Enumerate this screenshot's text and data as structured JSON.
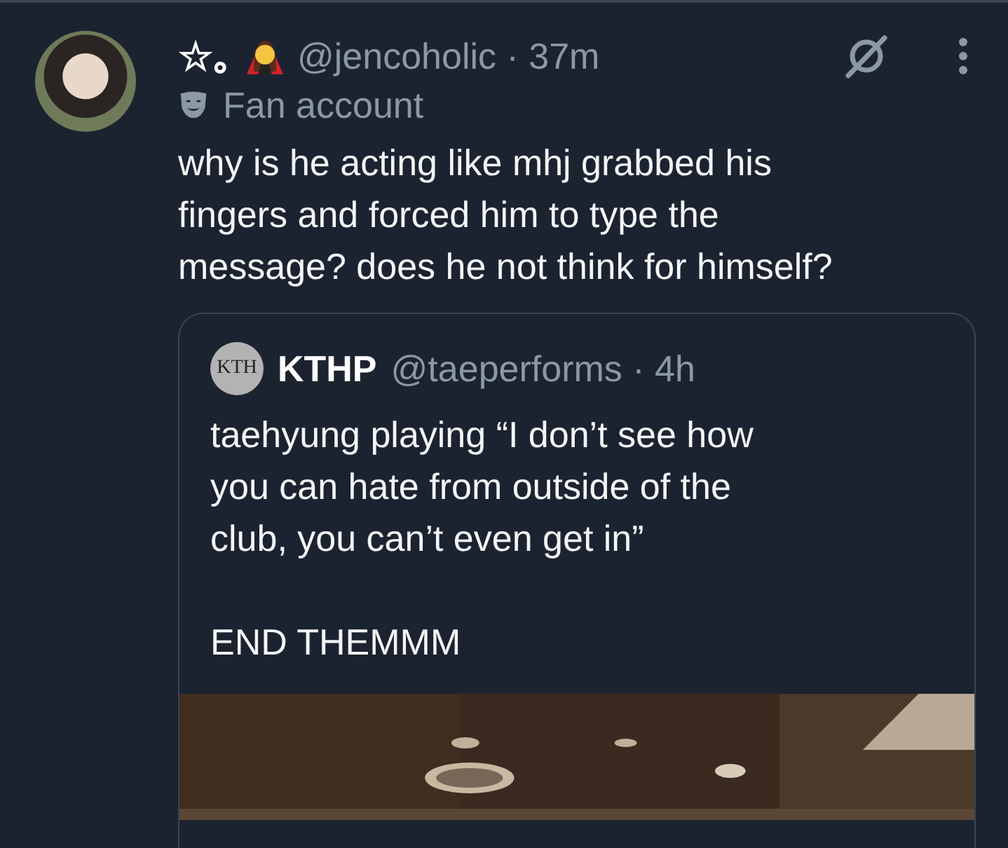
{
  "post": {
    "name": "☆｡",
    "meta": "@jencoholic · 37m",
    "badge": "Fan account",
    "text": "why is he acting like mhj grabbed his\nfingers and forced him to type the\nmessage? does he not think for himself?"
  },
  "quote": {
    "avatar_text": "KTH",
    "name": "KTHP",
    "meta": "@taeperforms · 4h",
    "text": "taehyung playing “I don’t see how\nyou can hate from outside of the\nclub, you can’t even get in”",
    "text_2": "END THEMMM"
  }
}
